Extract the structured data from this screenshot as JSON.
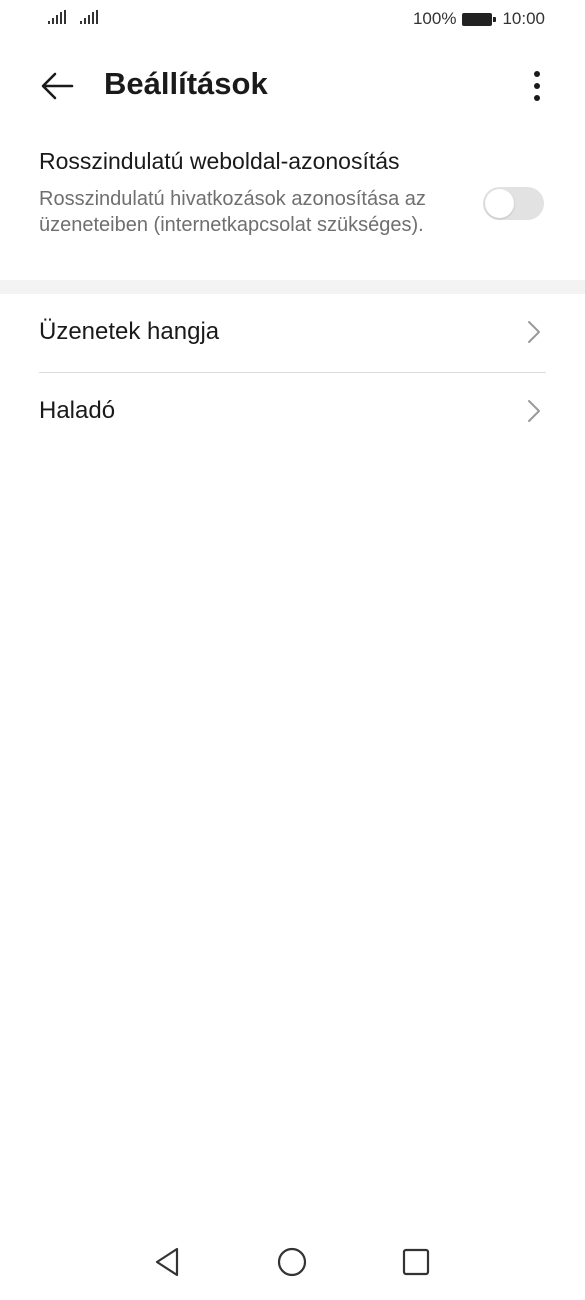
{
  "status_bar": {
    "battery_percent": "100%",
    "time": "10:00",
    "icons": [
      "signal-icon",
      "signal-icon",
      "battery-icon"
    ]
  },
  "header": {
    "title": "Beállítások",
    "back_icon": "arrow-left-icon",
    "more_icon": "more-vertical-icon"
  },
  "malicious_site": {
    "title": "Rosszindulatú weboldal-azonosítás",
    "description": "Rosszindulatú hivatkozások azonosítása az üzeneteiben (internetkapcsolat szükséges).",
    "toggle_on": false
  },
  "list": {
    "items": [
      {
        "label": "Üzenetek hangja",
        "icon": "chevron-right-icon"
      },
      {
        "label": "Haladó",
        "icon": "chevron-right-icon"
      }
    ]
  },
  "nav_bar": {
    "icons": [
      "back-triangle-icon",
      "home-circle-icon",
      "recents-square-icon"
    ]
  },
  "colors": {
    "text_primary": "#1a1a1a",
    "text_secondary": "#6f6f6f",
    "toggle_off": "#e2e2e2",
    "section_gap": "#f3f3f3",
    "divider": "#dcdcdc"
  }
}
